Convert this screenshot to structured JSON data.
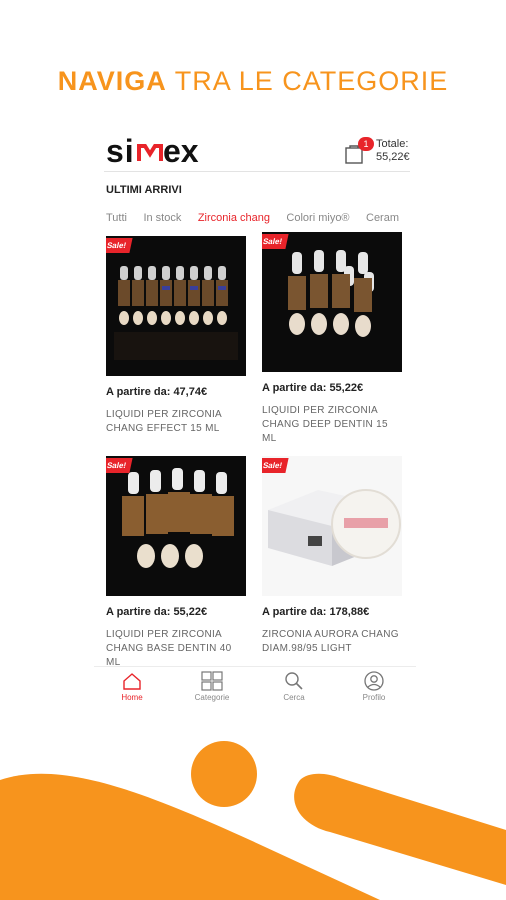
{
  "headline": {
    "strong": "NAVIGA",
    "light": " TRA LE CATEGORIE"
  },
  "app": {
    "logo_text": "simex",
    "cart_count": "1",
    "total_label": "Totale:",
    "total_value": "55,22€"
  },
  "section_title": "ULTIMI ARRIVI",
  "tabs": [
    "Tutti",
    "In stock",
    "Zirconia chang",
    "Colori miyo®",
    "Ceram"
  ],
  "active_tab": "Zirconia chang",
  "products": [
    {
      "badge": "Sale!",
      "price": "A partire da: 47,74€",
      "name": "LIQUIDI PER ZIRCONIA CHANG EFFECT 15 ML"
    },
    {
      "badge": "Sale!",
      "price": "A partire da: 55,22€",
      "name": "LIQUIDI PER ZIRCONIA CHANG DEEP DENTIN 15 ML"
    },
    {
      "badge": "Sale!",
      "price": "A partire da: 55,22€",
      "name": "LIQUIDI PER ZIRCONIA CHANG BASE DENTIN 40 ML"
    },
    {
      "badge": "Sale!",
      "price": "A partire da: 178,88€",
      "name": "ZIRCONIA AURORA CHANG DIAM.98/95 LIGHT"
    }
  ],
  "bottom_nav": [
    "Home",
    "Categorie",
    "Cerca",
    "Profilo"
  ],
  "colors": {
    "accent_orange": "#f7941d",
    "accent_red": "#e8242a"
  },
  "icons": [
    "cart-icon",
    "home-icon",
    "grid-icon",
    "search-icon",
    "profile-icon"
  ]
}
